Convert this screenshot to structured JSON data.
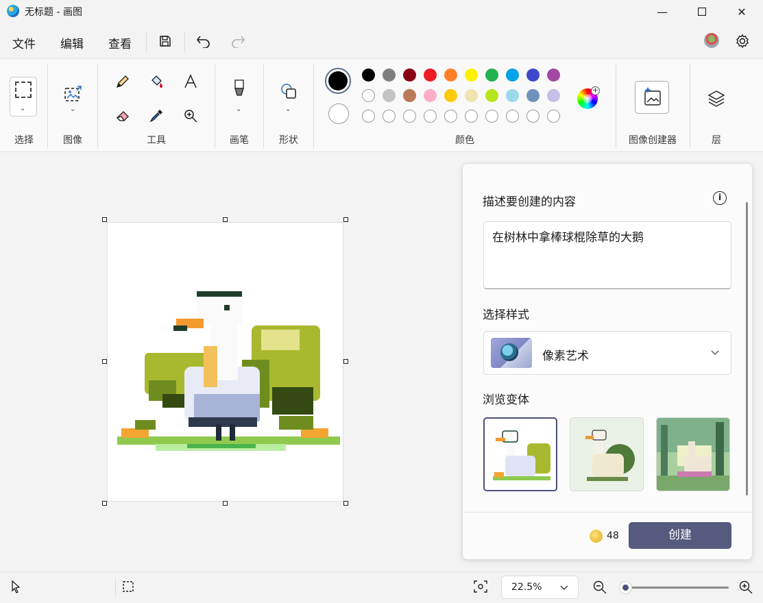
{
  "window": {
    "title": "无标题 - 画图",
    "minimize_glyph": "—",
    "maximize_glyph": "☐",
    "close_glyph": "✕"
  },
  "menu": {
    "file": "文件",
    "edit": "编辑",
    "view": "查看"
  },
  "ribbon": {
    "groups": {
      "select": "选择",
      "image": "图像",
      "tools": "工具",
      "brushes": "画笔",
      "shapes": "形状",
      "colors": "颜色",
      "image_creator": "图像创建器",
      "layers": "层"
    },
    "palette_row1": [
      "#000000",
      "#7f7f7f",
      "#880015",
      "#ed1c24",
      "#ff7f27",
      "#fff200",
      "#22b14c",
      "#00a2e8",
      "#3f48cc",
      "#a349a4"
    ],
    "palette_row2": [
      "#ffffff",
      "#c3c3c3",
      "#b97a57",
      "#ffaec9",
      "#ffc90e",
      "#efe4b0",
      "#b5e61d",
      "#99d9ea",
      "#7092be",
      "#c8bfe7"
    ],
    "primary_color": "#000000",
    "secondary_color": "#ffffff"
  },
  "panel": {
    "prompt_label": "描述要创建的内容",
    "prompt_text": "在树林中拿棒球棍除草的大鹅",
    "style_label": "选择样式",
    "style_value": "像素艺术",
    "variants_label": "浏览变体",
    "credits": "48",
    "create_button": "创建",
    "accent": "#555a7e"
  },
  "status": {
    "zoom": "22.5%",
    "zoom_level": 0.05
  }
}
